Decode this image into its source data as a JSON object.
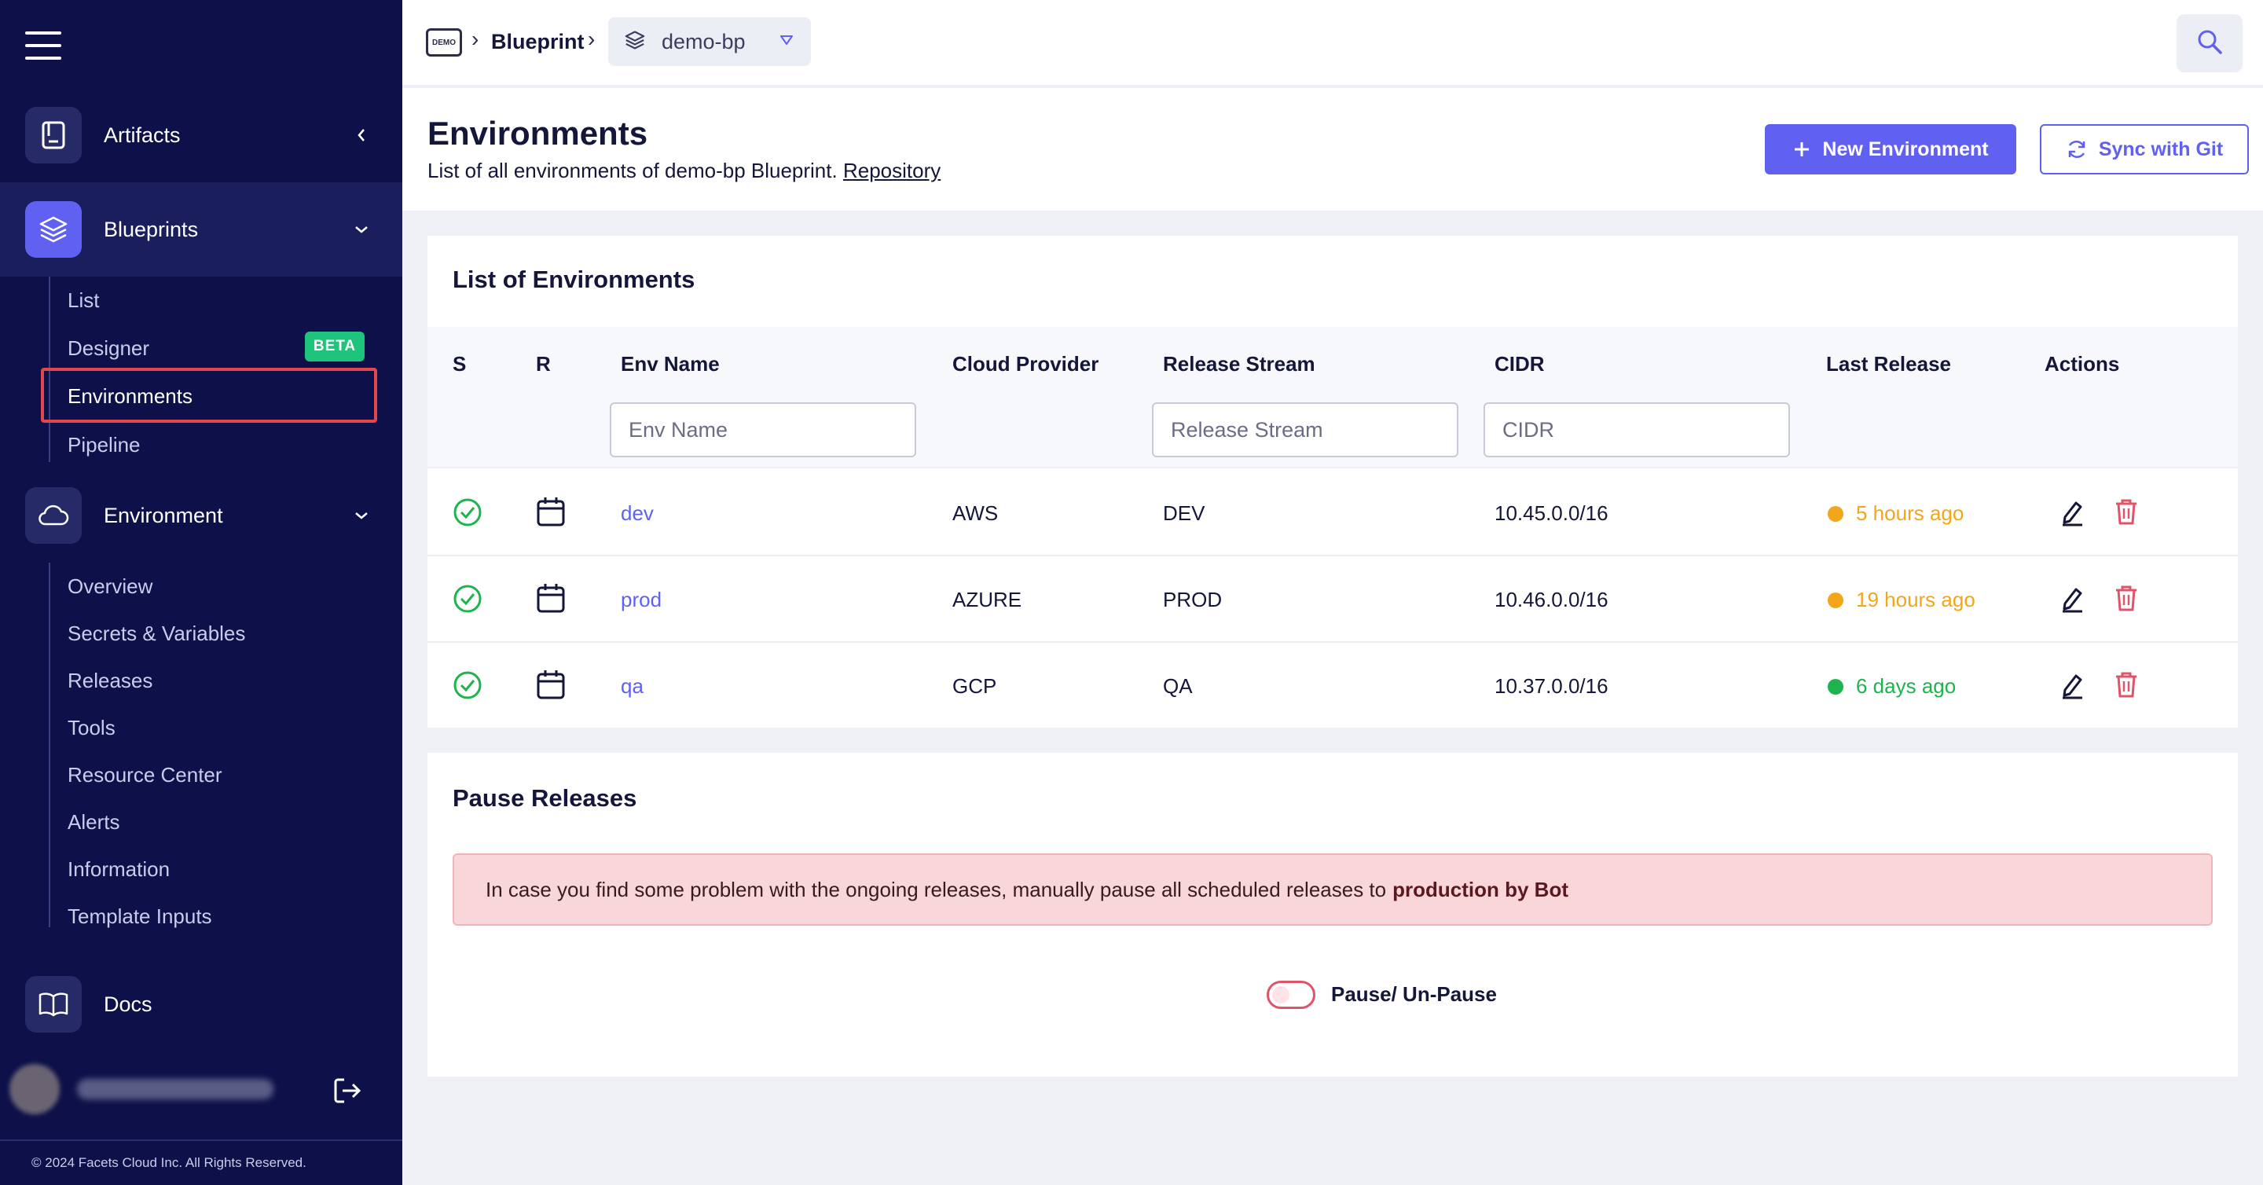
{
  "sidebar": {
    "groups": {
      "artifacts": "Artifacts",
      "blueprints": "Blueprints",
      "environment": "Environment",
      "docs": "Docs"
    },
    "blueprint_items": [
      "List",
      "Designer",
      "Environments",
      "Pipeline"
    ],
    "beta_badge": "BETA",
    "environment_items": [
      "Overview",
      "Secrets & Variables",
      "Releases",
      "Tools",
      "Resource Center",
      "Alerts",
      "Information",
      "Template Inputs"
    ],
    "copyright": "© 2024 Facets Cloud Inc. All Rights Reserved."
  },
  "topbar": {
    "logo_text": "DEMO",
    "separator": "›",
    "crumb": "Blueprint",
    "selected_blueprint": "demo-bp"
  },
  "header": {
    "title": "Environments",
    "subtitle": "List of all environments of demo-bp Blueprint.",
    "repo_link": "Repository",
    "new_env_button": "New Environment",
    "sync_button": "Sync with Git"
  },
  "env_table": {
    "title": "List of Environments",
    "columns": {
      "s": "S",
      "r": "R",
      "name": "Env Name",
      "cloud": "Cloud Provider",
      "stream": "Release Stream",
      "cidr": "CIDR",
      "last_release": "Last Release",
      "actions": "Actions"
    },
    "filters": {
      "name": "Env Name",
      "stream": "Release Stream",
      "cidr": "CIDR"
    },
    "rows": [
      {
        "name": "dev",
        "cloud": "AWS",
        "stream": "DEV",
        "cidr": "10.45.0.0/16",
        "last_release": "5 hours ago",
        "release_color": "#f2a71b"
      },
      {
        "name": "prod",
        "cloud": "AZURE",
        "stream": "PROD",
        "cidr": "10.46.0.0/16",
        "last_release": "19 hours ago",
        "release_color": "#f2a71b"
      },
      {
        "name": "qa",
        "cloud": "GCP",
        "stream": "QA",
        "cidr": "10.37.0.0/16",
        "last_release": "6 days ago",
        "release_color": "#1fb34e"
      }
    ]
  },
  "pause": {
    "title": "Pause Releases",
    "alert_text": "In case you find some problem with the ongoing releases, manually pause all scheduled releases to",
    "alert_bold": "production by Bot",
    "toggle_label": "Pause/ Un-Pause"
  },
  "colors": {
    "sidebar_bg": "#0e1149",
    "accent": "#6161f1",
    "success": "#1fb34e",
    "warning": "#f2a71b",
    "danger": "#e0546a"
  }
}
